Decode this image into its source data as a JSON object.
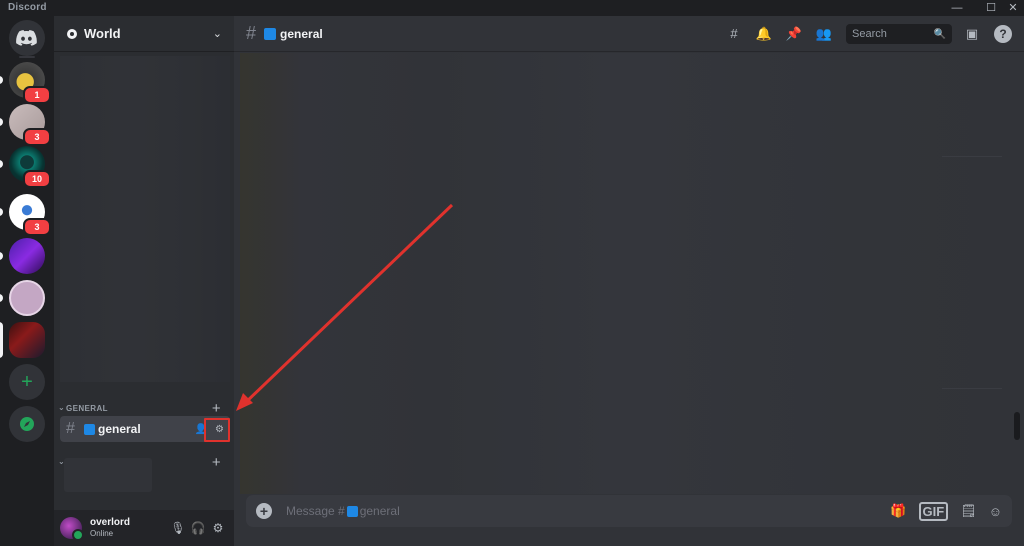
{
  "app": {
    "title": "Discord"
  },
  "window_controls": {
    "minimize": "—",
    "maximize": "☐",
    "close": "✕"
  },
  "servers": [
    {
      "icon": "discord-home-icon",
      "badge": ""
    },
    {
      "icon": "server-avatar-1",
      "badge": "1"
    },
    {
      "icon": "server-avatar-2",
      "badge": "3"
    },
    {
      "icon": "server-avatar-3",
      "badge": "10"
    },
    {
      "icon": "server-avatar-4",
      "badge": "3"
    },
    {
      "icon": "server-avatar-5",
      "badge": ""
    },
    {
      "icon": "server-avatar-6",
      "badge": ""
    },
    {
      "icon": "server-avatar-7",
      "badge": ""
    },
    {
      "icon": "add-server-icon",
      "badge": ""
    },
    {
      "icon": "explore-icon",
      "badge": ""
    }
  ],
  "server": {
    "name": "World"
  },
  "categories": [
    {
      "label": "GENERAL",
      "plus": "+"
    },
    {
      "label": "",
      "plus": "+"
    }
  ],
  "channel": {
    "name": "general",
    "hash": "#"
  },
  "user": {
    "name": "overlord",
    "status": "Online"
  },
  "search": {
    "placeholder": "Search"
  },
  "composer": {
    "placeholder_prefix": "Message #",
    "placeholder_channel": "general",
    "gif_label": "GIF"
  },
  "colors": {
    "accent": "#5865f2",
    "annotation": "#e0322d",
    "online": "#23a55a",
    "badge": "#f23f42"
  }
}
